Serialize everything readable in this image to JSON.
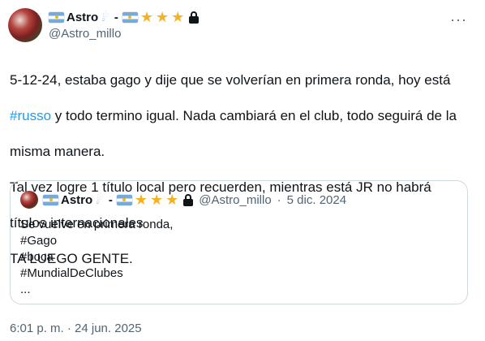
{
  "tweet": {
    "author": {
      "name": "Astro",
      "separator": "-",
      "handle": "@Astro_millo"
    },
    "text_lines": {
      "line1": "5-12-24, estaba gago y dije que se volverían en primera ronda, hoy está",
      "line2_hashtag": "#russo",
      "line2_rest": " y todo termino igual. Nada cambiará en el club, todo seguirá de la",
      "line3": "misma manera.",
      "line4": "Tal vez logre 1 título local pero recuerden, mientras está JR no habrá",
      "line5": "títulos internacionales",
      "line6": "TA LUEGO GENTE."
    },
    "timestamp": "6:01 p. m. · 24 jun. 2025"
  },
  "quote": {
    "author": {
      "name": "Astro",
      "separator": "-",
      "handle": "@Astro_millo",
      "date": "5 dic. 2024",
      "dot": "·"
    },
    "lines": [
      "Se vuelve en primera ronda,",
      "#Gago",
      "#boca",
      "#MundialDeClubes",
      "..."
    ]
  },
  "icons": {
    "flag": "argentina-flag-icon",
    "comet": "comet-icon",
    "star": "star-icon",
    "lock": "lock-icon",
    "more": "more-icon"
  },
  "colors": {
    "text": "#0f1419",
    "secondary": "#536471",
    "hashtag": "#1d9bf0",
    "border": "#cfd9de",
    "star": "#f5b324"
  }
}
